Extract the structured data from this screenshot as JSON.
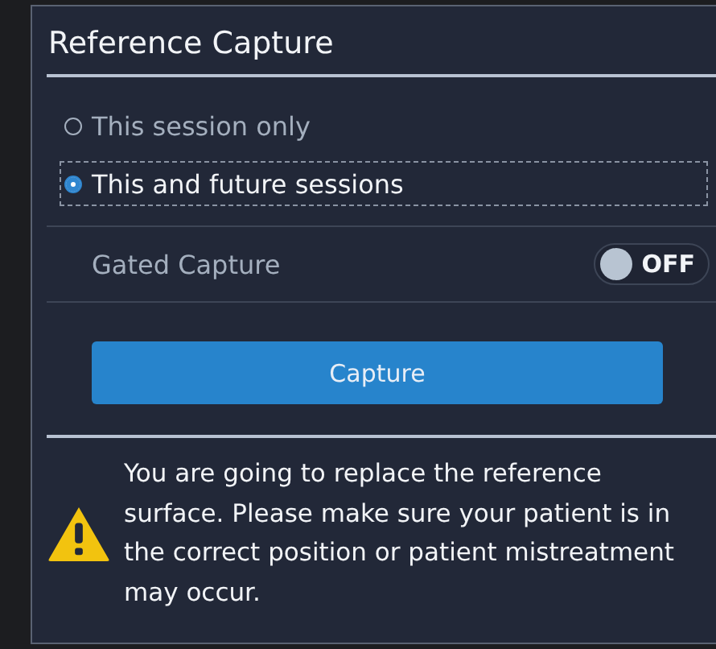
{
  "panel": {
    "title": "Reference Capture"
  },
  "options": [
    {
      "label": "This session only",
      "selected": false
    },
    {
      "label": "This and future sessions",
      "selected": true
    }
  ],
  "gated_capture": {
    "label": "Gated Capture",
    "on": false,
    "state_text": "OFF"
  },
  "capture_button": {
    "label": "Capture"
  },
  "warning": {
    "text": "You are going to replace the reference surface. Please make sure your patient is in the correct position or patient mistreatment may occur."
  }
}
